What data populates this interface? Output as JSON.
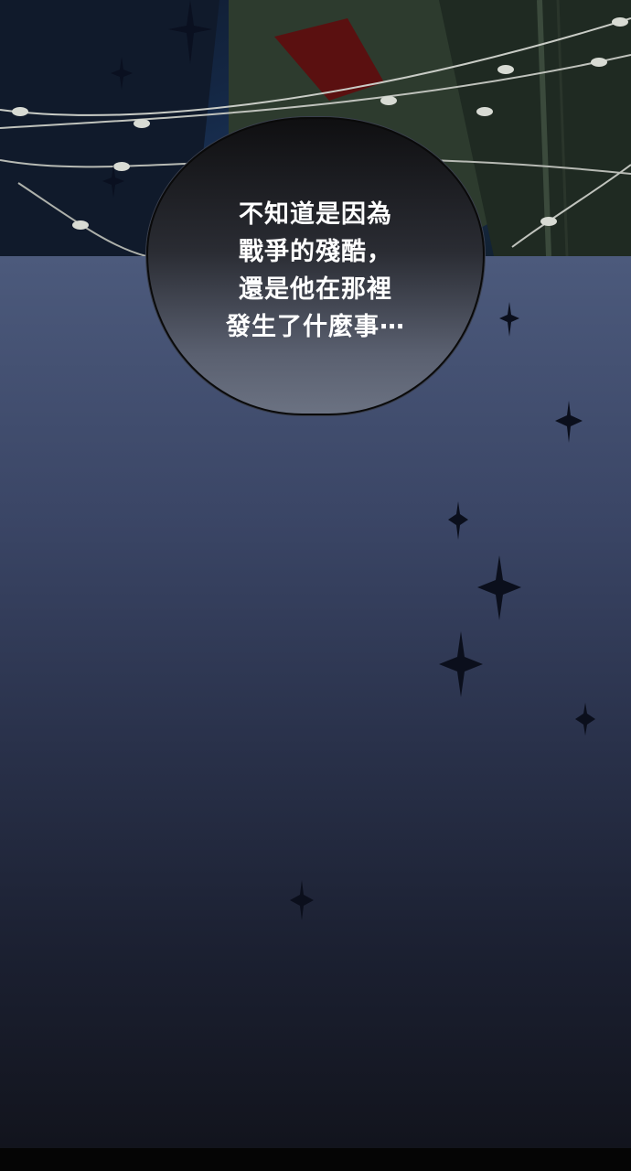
{
  "speech_bubble": {
    "lines": [
      "不知道是因為",
      "戰爭的殘酷，",
      "還是他在那裡",
      "發生了什麼事⋯"
    ]
  },
  "colors": {
    "sky_top": "#4c5a7c",
    "sky_bottom": "#12141d",
    "text": "#ffffff",
    "star": "#0b0f1c"
  }
}
